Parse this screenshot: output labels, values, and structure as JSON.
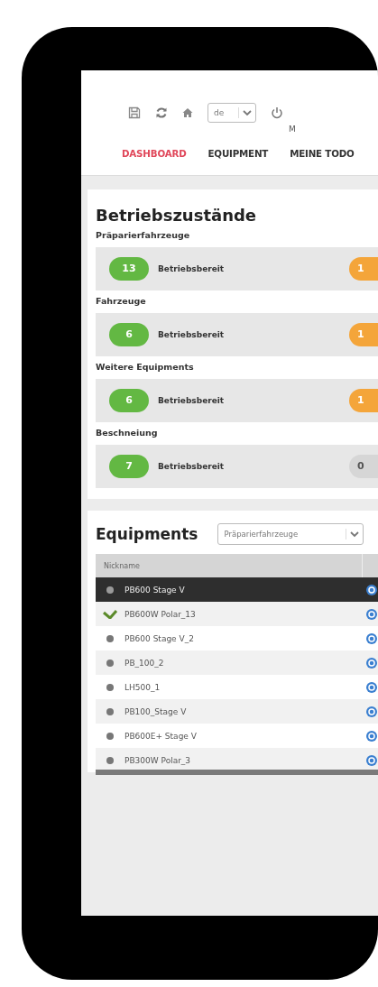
{
  "toolbar": {
    "language": "de",
    "user_label": "M"
  },
  "tabs": [
    {
      "label": "DASHBOARD",
      "selected": true
    },
    {
      "label": "EQUIPMENT",
      "selected": false
    },
    {
      "label": "MEINE TODO",
      "selected": false
    }
  ],
  "status_card": {
    "title": "Betriebszustände",
    "groups": [
      {
        "label": "Präparierfahrzeuge",
        "ready_count": "13",
        "ready_label": "Betriebsbereit",
        "other": {
          "count": "1",
          "color": "#f4a53a"
        }
      },
      {
        "label": "Fahrzeuge",
        "ready_count": "6",
        "ready_label": "Betriebsbereit",
        "other": {
          "count": "1",
          "color": "#f4a53a"
        }
      },
      {
        "label": "Weitere Equipments",
        "ready_count": "6",
        "ready_label": "Betriebsbereit",
        "other": {
          "count": "1",
          "color": "#f4a53a"
        }
      },
      {
        "label": "Beschneiung",
        "ready_count": "7",
        "ready_label": "Betriebsbereit",
        "other": {
          "count": "0",
          "color": "#d6d6d6"
        }
      }
    ]
  },
  "equipment_card": {
    "title": "Equipments",
    "filter": "Präparierfahrzeuge",
    "columns": [
      "Nickname"
    ],
    "rows": [
      {
        "name": "PB600 Stage V",
        "kind": "dot",
        "selected": true
      },
      {
        "name": "PB600W Polar_13",
        "kind": "check",
        "selected": false
      },
      {
        "name": "PB600 Stage V_2",
        "kind": "dot",
        "selected": false
      },
      {
        "name": "PB_100_2",
        "kind": "dot",
        "selected": false
      },
      {
        "name": "LH500_1",
        "kind": "dot",
        "selected": false
      },
      {
        "name": "PB100_Stage V",
        "kind": "dot",
        "selected": false
      },
      {
        "name": "PB600E+ Stage V",
        "kind": "dot",
        "selected": false
      },
      {
        "name": "PB300W Polar_3",
        "kind": "dot",
        "selected": false
      }
    ]
  }
}
